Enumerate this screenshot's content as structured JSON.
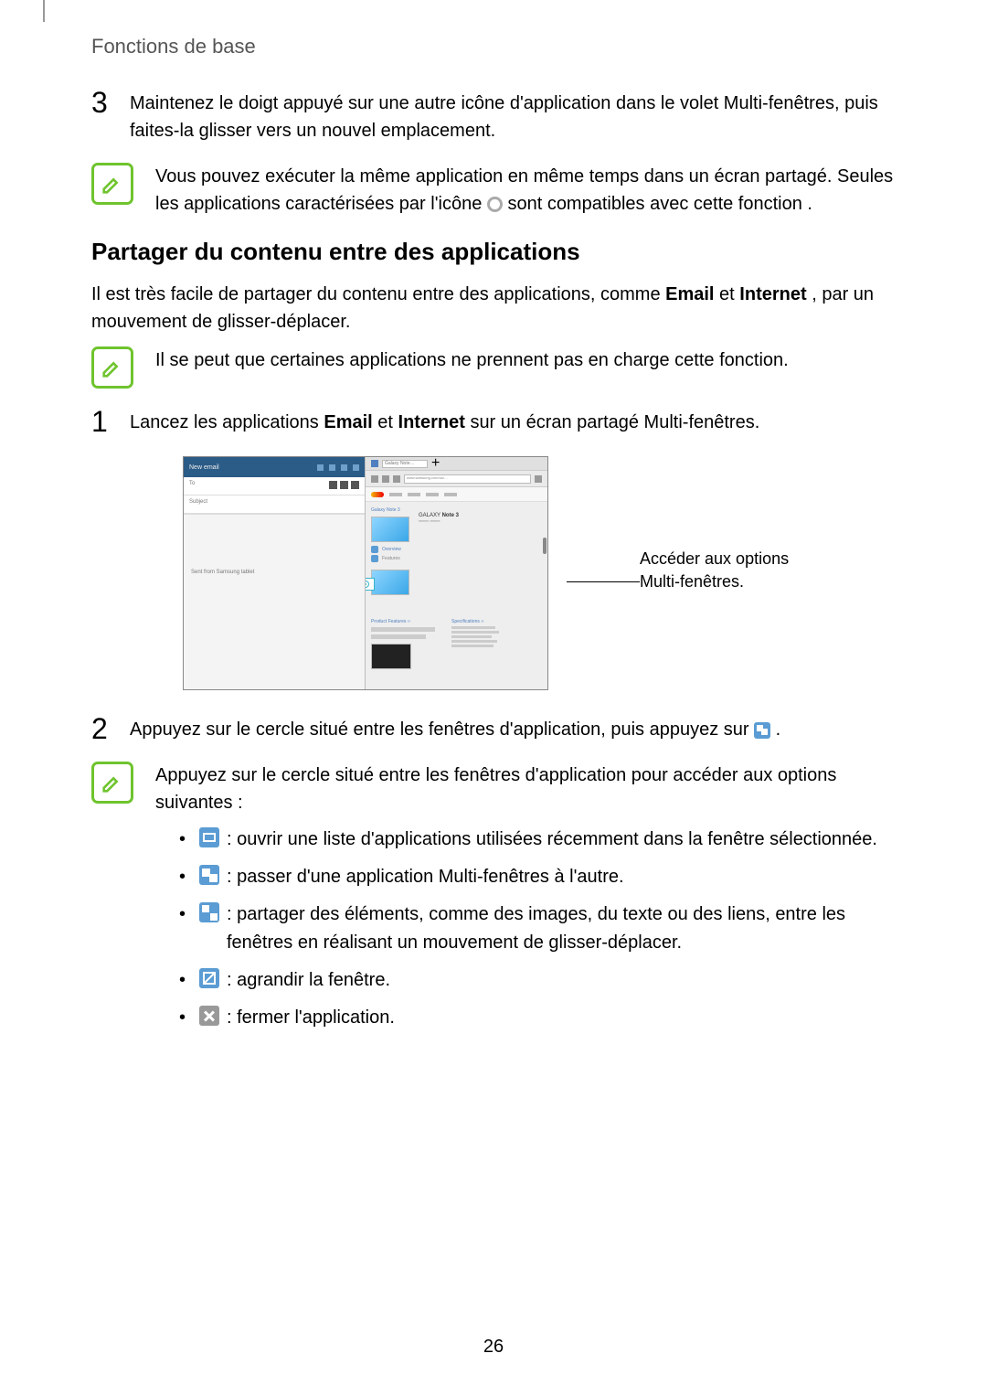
{
  "header": "Fonctions de base",
  "step3": {
    "num": "3",
    "text": "Maintenez le doigt appuyé sur une autre icône d'application dans le volet Multi-fenêtres, puis faites-la glisser vers un nouvel emplacement."
  },
  "note1": {
    "before": "Vous pouvez exécuter la même application en même temps dans un écran partagé. Seules les applications caractérisées par l'icône ",
    "after": " sont compatibles avec cette fonction ."
  },
  "section_heading": "Partager du contenu entre des applications",
  "intro_para": {
    "before": "Il est très facile de partager du contenu entre des applications, comme ",
    "b1": "Email",
    "mid": " et ",
    "b2": "Internet",
    "after": ", par un mouvement de glisser-déplacer."
  },
  "note2": "Il se peut que certaines applications ne prennent pas en charge cette fonction.",
  "step1": {
    "num": "1",
    "before": "Lancez les applications ",
    "b1": "Email",
    "mid": " et ",
    "b2": "Internet",
    "after": " sur un écran partagé Multi-fenêtres."
  },
  "figure_caption": "Accéder aux options Multi-fenêtres.",
  "step2": {
    "num": "2",
    "before": "Appuyez sur le cercle situé entre les fenêtres d'application, puis appuyez sur ",
    "after": "."
  },
  "note3": "Appuyez sur le cercle situé entre les fenêtres d'application pour accéder aux options suivantes :",
  "options": {
    "list": ": ouvrir une liste d'applications utilisées récemment dans la fenêtre sélectionnée.",
    "swap": ": passer d'une application Multi-fenêtres à l'autre.",
    "share": ": partager des éléments, comme des images, du texte ou des liens, entre les fenêtres en réalisant un mouvement de glisser-déplacer.",
    "expand": ": agrandir la fenêtre.",
    "close": ": fermer l'application."
  },
  "page_number": "26"
}
